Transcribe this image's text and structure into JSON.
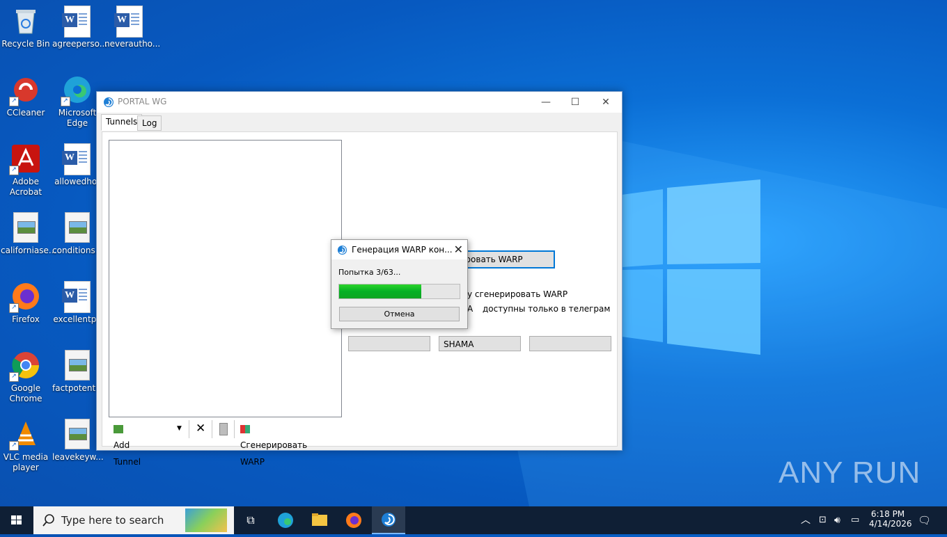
{
  "desktop": {
    "icons": [
      {
        "label": "Recycle Bin"
      },
      {
        "label": "agreeperso..."
      },
      {
        "label": "neverautho..."
      },
      {
        "label": "CCleaner"
      },
      {
        "label": "Microsoft Edge"
      },
      {
        "label": "Adobe Acrobat"
      },
      {
        "label": "allowedhot"
      },
      {
        "label": "californiase..."
      },
      {
        "label": "conditions..."
      },
      {
        "label": "Firefox"
      },
      {
        "label": "excellentpa"
      },
      {
        "label": "Google Chrome"
      },
      {
        "label": "factpotenti..."
      },
      {
        "label": "VLC media player"
      },
      {
        "label": "leavekeyw..."
      }
    ]
  },
  "window": {
    "title": "PORTAL WG",
    "tabs": [
      {
        "label": "Tunnels"
      },
      {
        "label": "Log"
      }
    ],
    "toolbar": {
      "add_tunnel": "Add Tunnel",
      "generate_warp": "Сгенерировать WARP"
    },
    "right": {
      "warp_button_partial": "рировать WARP",
      "line1_partial": "у сгенерировать WARP",
      "line2_a": "А",
      "line2_b": "доступны только в телеграм",
      "field1": "",
      "field2": "SHAMA",
      "field3": ""
    }
  },
  "dialog": {
    "title": "Генерация WARP кон...",
    "status": "Попытка 3/63...",
    "progress_fraction": 0.68,
    "cancel": "Отмена"
  },
  "taskbar": {
    "search_placeholder": "Type here to search",
    "time": "6:18 PM",
    "date": "4/14/2026"
  },
  "watermark": "ANY RUN"
}
